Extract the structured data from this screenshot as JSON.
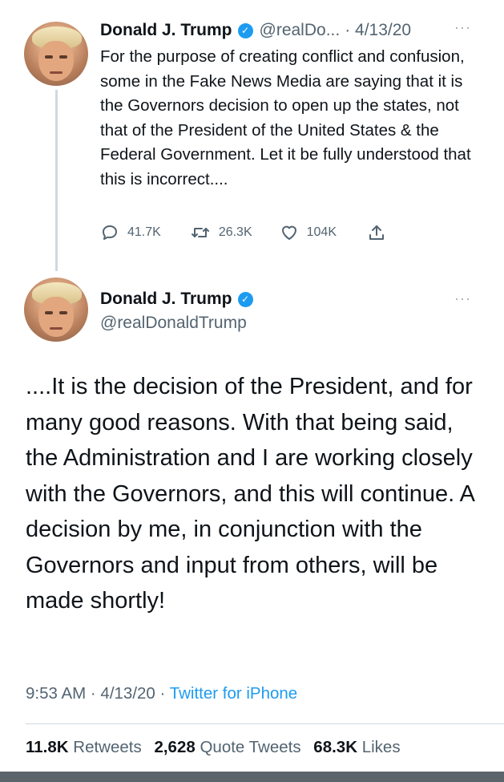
{
  "tweet1": {
    "name": "Donald J. Trump",
    "handle": "@realDo...",
    "date": "· 4/13/20",
    "text": "For the purpose of creating conflict and confusion, some in the Fake News Media are saying that it is the Governors decision to open up the states, not that of the President of the United States & the Federal Government. Let it be fully understood that this is incorrect....",
    "replies": "41.7K",
    "retweets": "26.3K",
    "likes": "104K",
    "more": "···"
  },
  "tweet2": {
    "name": "Donald J. Trump",
    "handle": "@realDonaldTrump",
    "more": "···",
    "text": "....It is the decision of the President, and for many good reasons. With that being said, the Administration and I are working closely with the Governors, and this will continue. A decision by me, in conjunction with the Governors and input from others, will be made shortly!",
    "time": "9:53 AM · 4/13/20 ·",
    "source": "Twitter for iPhone",
    "retweets_count": "11.8K",
    "retweets_label": "Retweets",
    "quotes_count": "2,628",
    "quotes_label": "Quote Tweets",
    "likes_count": "68.3K",
    "likes_label": "Likes"
  },
  "colors": {
    "accent": "#1d9bf0",
    "text": "#0f1419",
    "muted": "#536471",
    "border": "#cfd9de"
  },
  "icons": [
    "reply-icon",
    "retweet-icon",
    "like-icon",
    "share-icon",
    "verified-badge-icon",
    "more-icon"
  ]
}
